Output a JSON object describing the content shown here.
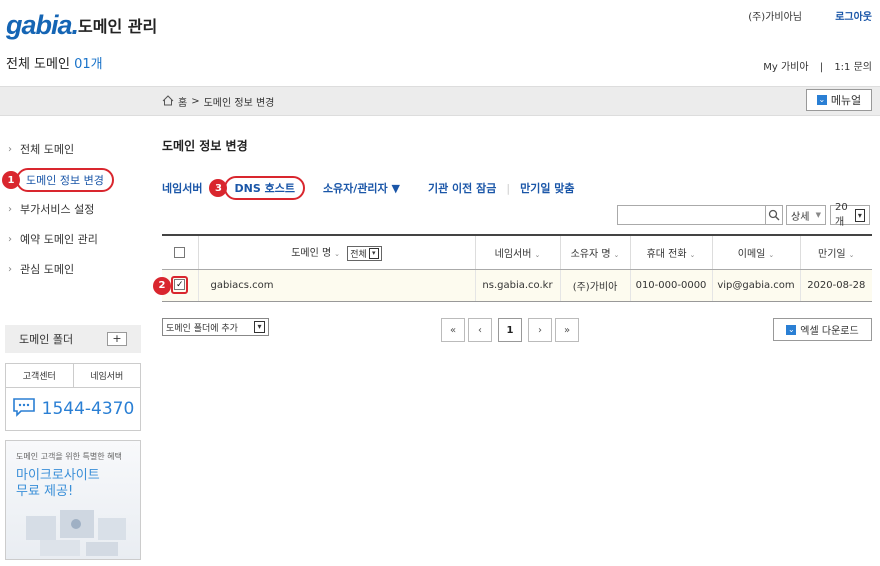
{
  "header": {
    "logo": "gabia.",
    "app_title": "도메인 관리",
    "user_name": "(주)가비아님",
    "logout": "로그아웃",
    "total_label": "전체 도메인",
    "total_count": "01개",
    "my_gabia": "My 가비아",
    "separator": "|",
    "inquiry": "1:1 문의"
  },
  "breadcrumb": {
    "home": "홈",
    "arrow": ">",
    "current": "도메인 정보 변경"
  },
  "menu_button": "메뉴얼",
  "sidebar": {
    "items": [
      {
        "label": "전체 도메인"
      },
      {
        "label": "도메인 정보 변경"
      },
      {
        "label": "부가서비스 설정"
      },
      {
        "label": "예약 도메인 관리"
      },
      {
        "label": "관심 도메인"
      }
    ],
    "folder_label": "도메인 폴더",
    "folder_add": "+",
    "support_tabs": [
      "고객센터",
      "네임서버"
    ],
    "phone": "1544-4370",
    "promo_small": "도메인 고객을 위한 특별한 혜택",
    "promo_big_1": "마이크로사이트",
    "promo_big_2": "무료 제공!"
  },
  "main": {
    "heading": "도메인 정보 변경",
    "tabs": [
      "네임서버",
      "DNS 호스트",
      "소유자/관리자 ▼",
      "기관 이전 잠금",
      "만기일 맞춤"
    ],
    "tab_sep": "|",
    "search_mode": "상세",
    "page_size": "20개",
    "table": {
      "columns": [
        "도메인 명",
        "네임서버",
        "소유자 명",
        "휴대 전화",
        "이메일",
        "만기일"
      ],
      "filter_value": "전체",
      "rows": [
        {
          "domain": "gabiacs.com",
          "ns": "ns.gabia.co.kr",
          "owner": "(주)가비아",
          "phone": "010-000-0000",
          "email": "vip@gabia.com",
          "expiry": "2020-08-28",
          "checked": "✓"
        }
      ]
    },
    "folder_add_select": "도메인 폴더에 추가",
    "pager": {
      "first": "«",
      "prev": "‹",
      "current": "1",
      "next": "›",
      "last": "»"
    },
    "excel_button": "엑셀 다운로드"
  },
  "annotations": [
    "1",
    "2",
    "3"
  ],
  "colors": {
    "accent": "#1a56a8",
    "highlight": "#d9262e",
    "row_bg": "#fdfbef"
  }
}
